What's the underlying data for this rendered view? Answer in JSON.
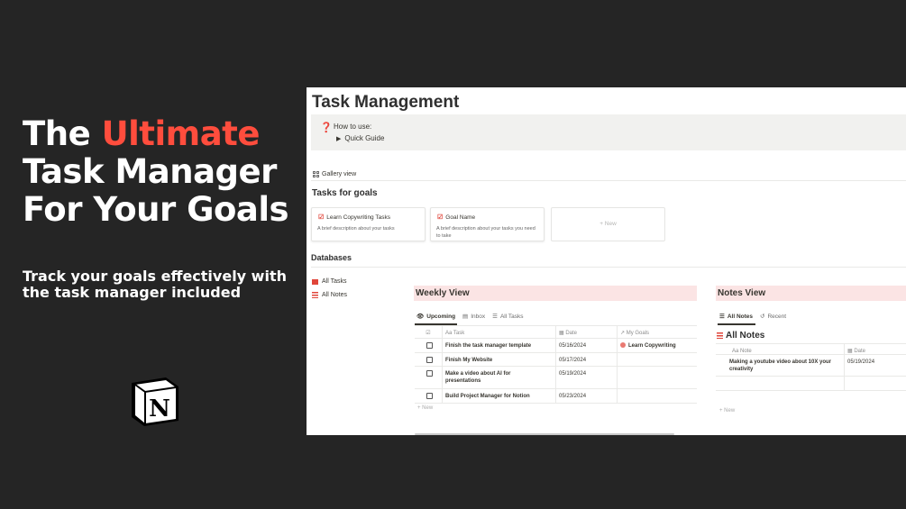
{
  "promo": {
    "title_line1_pre": "The ",
    "title_line1_accent": "Ultimate",
    "title_line2": "Task Manager",
    "title_line3": "For Your Goals",
    "subtitle_line1": "Track your goals effectively with",
    "subtitle_line2": "the task manager included",
    "accent_color": "#ff4d3d",
    "logo_icon": "notion-logo-icon",
    "logo_letter": "N"
  },
  "page": {
    "title": "Task Management",
    "callout": {
      "icon": "question-icon",
      "text": "How to use:",
      "toggle_label": "Quick Guide"
    },
    "gallery_tab": "Gallery view",
    "tasks_heading": "Tasks for goals",
    "cards": [
      {
        "title": "Learn Copywriting Tasks",
        "description": "A brief description about your tasks"
      },
      {
        "title": "Goal Name",
        "description": "A brief description about your tasks you need to take"
      }
    ],
    "card_new": "+ New",
    "databases_heading": "Databases",
    "db_links": [
      "All Tasks",
      "All Notes"
    ]
  },
  "weekly": {
    "title": "Weekly View",
    "tabs": [
      "Upcoming",
      "Inbox",
      "All Tasks"
    ],
    "columns": [
      "Aa Task",
      "Date",
      "My Goals"
    ],
    "rows": [
      {
        "task": "Finish the task manager template",
        "date": "05/16/2024",
        "goal": "Learn Copywriting"
      },
      {
        "task": "Finish My Website",
        "date": "05/17/2024",
        "goal": ""
      },
      {
        "task": "Make a video about AI for presentations",
        "date": "05/19/2024",
        "goal": ""
      },
      {
        "task": "Build Project Manager for Notion",
        "date": "05/23/2024",
        "goal": ""
      }
    ],
    "new_label": "+ New"
  },
  "notes": {
    "title": "Notes View",
    "tabs": [
      "All Notes",
      "Recent"
    ],
    "heading": "All Notes",
    "columns": [
      "Aa Note",
      "Date"
    ],
    "rows": [
      {
        "note": "Making a youtube video about 10X your creativity",
        "date": "05/19/2024"
      }
    ],
    "new_label": "+ New"
  }
}
